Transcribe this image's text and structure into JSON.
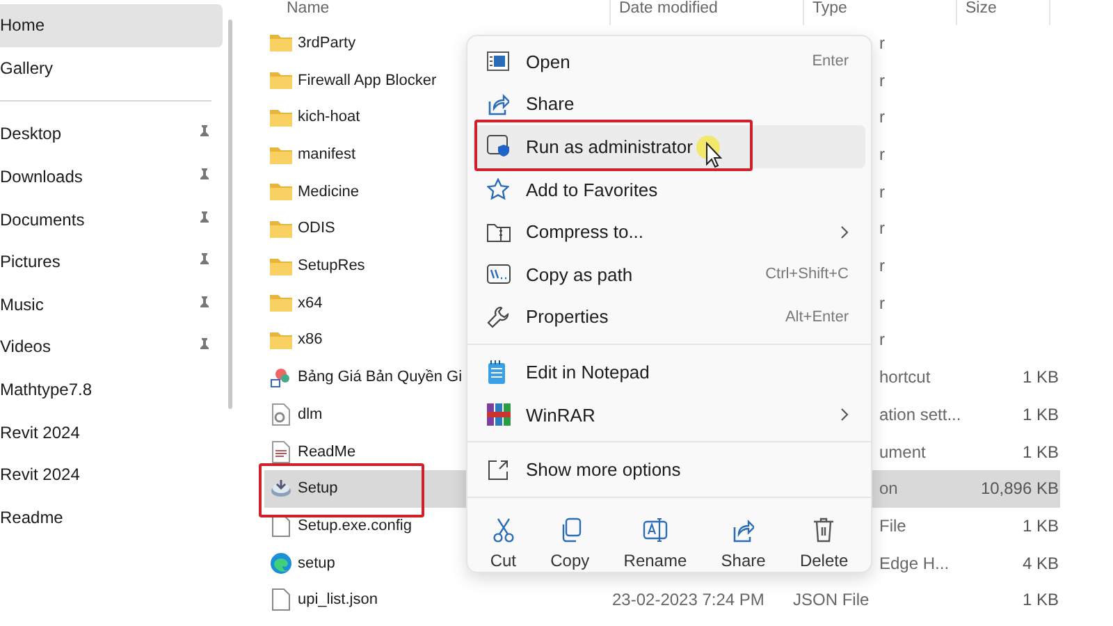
{
  "sidebar": {
    "sections": [
      [
        {
          "label": "Home",
          "selected": true,
          "pinned": false
        },
        {
          "label": "Gallery",
          "selected": false,
          "pinned": false
        }
      ],
      [
        {
          "label": "Desktop",
          "selected": false,
          "pinned": true
        },
        {
          "label": "Downloads",
          "selected": false,
          "pinned": true
        },
        {
          "label": "Documents",
          "selected": false,
          "pinned": true
        },
        {
          "label": "Pictures",
          "selected": false,
          "pinned": true
        },
        {
          "label": "Music",
          "selected": false,
          "pinned": true
        },
        {
          "label": "Videos",
          "selected": false,
          "pinned": true
        },
        {
          "label": "Mathtype7.8",
          "selected": false,
          "pinned": false
        },
        {
          "label": "Revit 2024",
          "selected": false,
          "pinned": false
        },
        {
          "label": "Revit 2024",
          "selected": false,
          "pinned": false
        },
        {
          "label": "Readme",
          "selected": false,
          "pinned": false
        }
      ]
    ]
  },
  "files": {
    "columns": [
      "Name",
      "Date modified",
      "Type",
      "Size"
    ],
    "rows": [
      {
        "name": "3rdParty",
        "kind": "folder",
        "type": "r",
        "selected": false
      },
      {
        "name": "Firewall App Blocker",
        "kind": "folder",
        "type": "r",
        "selected": false
      },
      {
        "name": "kich-hoat",
        "kind": "folder",
        "type": "r",
        "selected": false
      },
      {
        "name": "manifest",
        "kind": "folder",
        "type": "r",
        "selected": false
      },
      {
        "name": "Medicine",
        "kind": "folder",
        "type": "r",
        "selected": false
      },
      {
        "name": "ODIS",
        "kind": "folder",
        "type": "r",
        "selected": false
      },
      {
        "name": "SetupRes",
        "kind": "folder",
        "type": "r",
        "selected": false
      },
      {
        "name": "x64",
        "kind": "folder",
        "type": "r",
        "selected": false
      },
      {
        "name": "x86",
        "kind": "folder",
        "type": "r",
        "selected": false
      },
      {
        "name": "Bảng Giá Bản Quyền Gi",
        "kind": "shortcut",
        "type": "hortcut",
        "size": "1 KB",
        "selected": false
      },
      {
        "name": "dlm",
        "kind": "settings",
        "type": "ation sett...",
        "size": "1 KB",
        "selected": false
      },
      {
        "name": "ReadMe",
        "kind": "document",
        "type": "ument",
        "size": "1 KB",
        "selected": false
      },
      {
        "name": "Setup",
        "kind": "setup",
        "type": "on",
        "size": "10,896 KB",
        "selected": true
      },
      {
        "name": "Setup.exe.config",
        "kind": "file",
        "type": "File",
        "size": "1 KB",
        "selected": false
      },
      {
        "name": "setup",
        "kind": "edge",
        "type": "Edge H...",
        "size": "4 KB",
        "selected": false
      },
      {
        "name": "upi_list.json",
        "kind": "file",
        "date": "23-02-2023 7:24 PM",
        "type": "JSON File",
        "size": "1 KB",
        "selected": false
      }
    ]
  },
  "context_menu": {
    "groups": [
      [
        {
          "label": "Open",
          "kind": "open",
          "shortcut": "Enter",
          "submenu": false,
          "hovered": false
        },
        {
          "label": "Share",
          "kind": "share",
          "submenu": false,
          "hovered": false
        },
        {
          "label": "Run as administrator",
          "kind": "admin",
          "submenu": false,
          "hovered": true
        },
        {
          "label": "Add to Favorites",
          "kind": "star",
          "submenu": false,
          "hovered": false
        },
        {
          "label": "Compress to...",
          "kind": "zip",
          "submenu": true,
          "hovered": false
        },
        {
          "label": "Copy as path",
          "kind": "path",
          "shortcut": "Ctrl+Shift+C",
          "submenu": false,
          "hovered": false
        },
        {
          "label": "Properties",
          "kind": "wrench",
          "shortcut": "Alt+Enter",
          "submenu": false,
          "hovered": false
        }
      ],
      [
        {
          "label": "Edit in Notepad",
          "kind": "notepad",
          "submenu": false,
          "hovered": false
        },
        {
          "label": "WinRAR",
          "kind": "winrar",
          "submenu": true,
          "hovered": false
        }
      ],
      [
        {
          "label": "Show more options",
          "kind": "more",
          "submenu": false,
          "hovered": false
        }
      ]
    ],
    "actions": [
      {
        "label": "Cut",
        "kind": "cut"
      },
      {
        "label": "Copy",
        "kind": "copy"
      },
      {
        "label": "Rename",
        "kind": "rename"
      },
      {
        "label": "Share",
        "kind": "share"
      },
      {
        "label": "Delete",
        "kind": "delete"
      }
    ]
  }
}
